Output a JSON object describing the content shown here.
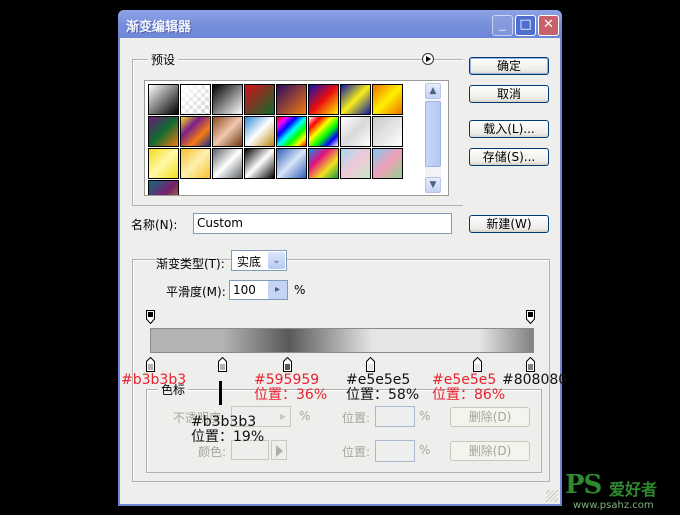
{
  "window": {
    "title": "渐变编辑器",
    "controls": {
      "minimize": "_",
      "maximize": "□",
      "close": "✕"
    }
  },
  "presets": {
    "legend": "预设",
    "menu_icon": "play-circle-icon",
    "swatches": [
      {
        "name": "foreground-to-background",
        "colors": [
          "#ffffff",
          "#000000"
        ]
      },
      {
        "name": "foreground-to-transparent",
        "colors": [
          "#ffffff",
          "transparent"
        ]
      },
      {
        "name": "black-white",
        "colors": [
          "#000000",
          "#ffffff"
        ]
      },
      {
        "name": "red-green",
        "colors": [
          "#d4101b",
          "#0e6b2c"
        ]
      },
      {
        "name": "violet-orange",
        "colors": [
          "#2a0a5e",
          "#f47b12"
        ]
      },
      {
        "name": "blue-red-yellow",
        "colors": [
          "#0a14b4",
          "#e80c0c",
          "#fff200"
        ]
      },
      {
        "name": "blue-yellow-blue",
        "colors": [
          "#0a14a8",
          "#f7ee18",
          "#0a14a8"
        ]
      },
      {
        "name": "orange-yellow-orange",
        "colors": [
          "#f07000",
          "#fff000",
          "#f07000"
        ]
      },
      {
        "name": "violet-green-orange",
        "colors": [
          "#6a1a7a",
          "#106b2e",
          "#f47b12"
        ]
      },
      {
        "name": "yellow-violet-orange-blue",
        "colors": [
          "#f9e21a",
          "#7a1f8a",
          "#f47b12",
          "#1a2a8a"
        ]
      },
      {
        "name": "copper",
        "colors": [
          "#8a4a1e",
          "#f1c8b0",
          "#6e3410"
        ]
      },
      {
        "name": "chrome",
        "colors": [
          "#2e88d8",
          "#ffffff",
          "#b8860b"
        ]
      },
      {
        "name": "spectrum",
        "colors": [
          "#ff0000",
          "#ff00ff",
          "#0000ff",
          "#00ffff",
          "#00ff00",
          "#ffff00",
          "#ff0000"
        ]
      },
      {
        "name": "transparent-rainbow",
        "colors": [
          "#ffffff",
          "#ff0000",
          "#ffff00",
          "#00ff00",
          "#0000ff",
          "#ffffff"
        ]
      },
      {
        "name": "transparent-stripes",
        "colors": [
          "#ffffff",
          "#d8d8d8",
          "#ffffff"
        ]
      },
      {
        "name": "neutral-density",
        "colors": [
          "#c8c8c8",
          "#ffffff"
        ]
      },
      {
        "name": "yellow-stripes",
        "colors": [
          "#f4dc1a",
          "#fff8a8",
          "#f4dc1a"
        ]
      },
      {
        "name": "orange-stripes",
        "colors": [
          "#f8c030",
          "#fff0b0",
          "#f8c030"
        ]
      },
      {
        "name": "steel-stripes",
        "colors": [
          "#5c6064",
          "#ffffff",
          "#5c6064"
        ]
      },
      {
        "name": "black-stripes",
        "colors": [
          "#000000",
          "#ffffff",
          "#000000"
        ]
      },
      {
        "name": "blue-stripes",
        "colors": [
          "#2f5eb8",
          "#d8e6f8",
          "#2f5eb8"
        ]
      },
      {
        "name": "rainbow-diagonal",
        "colors": [
          "#1090e0",
          "#e01080",
          "#f0e020",
          "#10a040"
        ]
      },
      {
        "name": "pastel",
        "colors": [
          "#a8d8f0",
          "#f0c8d8",
          "#c8e8c8"
        ]
      },
      {
        "name": "pastel-2",
        "colors": [
          "#80c8f0",
          "#f0a0b8",
          "#90d090"
        ]
      },
      {
        "name": "teal-violet-orange",
        "colors": [
          "#106a80",
          "#7a1f6a",
          "#b8a020"
        ]
      }
    ]
  },
  "buttons": {
    "ok": "确定",
    "cancel": "取消",
    "load": "载入(L)...",
    "save": "存储(S)...",
    "new": "新建(W)"
  },
  "name_field": {
    "label": "名称(N):",
    "value": "Custom"
  },
  "gradient": {
    "type_label": "渐变类型(T):",
    "type_value": "实底",
    "smoothness_label": "平滑度(M):",
    "smoothness_value": "100",
    "smoothness_unit": "%",
    "opacity_stops": [
      {
        "position_pct": 0,
        "color": "#000000"
      },
      {
        "position_pct": 100,
        "color": "#000000"
      }
    ],
    "color_stops": [
      {
        "position_pct": 0,
        "color": "#b3b3b3"
      },
      {
        "position_pct": 19,
        "color": "#b3b3b3"
      },
      {
        "position_pct": 36,
        "color": "#595959"
      },
      {
        "position_pct": 58,
        "color": "#e5e5e5"
      },
      {
        "position_pct": 86,
        "color": "#e5e5e5"
      },
      {
        "position_pct": 100,
        "color": "#808080"
      }
    ]
  },
  "stops_panel": {
    "legend": "色标",
    "opacity_label": "不透明度:",
    "opacity_unit": "%",
    "location_label": "位置:",
    "location_unit": "%",
    "delete_label": "删除(D)",
    "color_label": "颜色:"
  },
  "annotations": [
    {
      "text": "#b3b3b3",
      "color": "#e8232e"
    },
    {
      "text": "#595959",
      "color": "#e8232e"
    },
    {
      "text": "位置：36%",
      "color": "#e8232e"
    },
    {
      "text": "#e5e5e5",
      "color": "#111111"
    },
    {
      "text": "位置：58%",
      "color": "#111111"
    },
    {
      "text": "#e5e5e5",
      "color": "#e8232e"
    },
    {
      "text": "位置：86%",
      "color": "#e8232e"
    },
    {
      "text": "#808080",
      "color": "#111111"
    },
    {
      "text": "#b3b3b3",
      "color": "#111111"
    },
    {
      "text": "位置：19%",
      "color": "#111111"
    }
  ],
  "watermark": {
    "brand": "PS",
    "brand_cn": "爱好者",
    "url": "www.psahz.com"
  }
}
